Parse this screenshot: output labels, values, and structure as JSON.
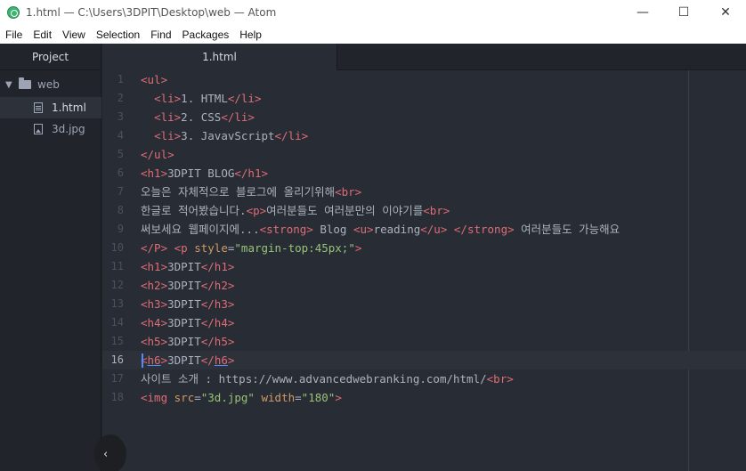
{
  "window": {
    "title": "1.html — C:\\Users\\3DPIT\\Desktop\\web — Atom",
    "minimize_glyph": "—",
    "maximize_glyph": "☐",
    "close_glyph": "✕",
    "app_icon": "atom-icon"
  },
  "menu": [
    "File",
    "Edit",
    "View",
    "Selection",
    "Find",
    "Packages",
    "Help"
  ],
  "sidebar": {
    "header": "Project",
    "tree": [
      {
        "label": "web",
        "type": "folder",
        "icon": "folder-icon",
        "expanded": true
      },
      {
        "label": "1.html",
        "type": "file",
        "icon": "file-text-icon",
        "selected": true
      },
      {
        "label": "3d.jpg",
        "type": "file",
        "icon": "file-image-icon"
      }
    ],
    "collapse_glyph": "‹"
  },
  "tabs": [
    {
      "label": "1.html",
      "active": true
    }
  ],
  "editor": {
    "cursor_line": 16,
    "lines": [
      {
        "n": "1",
        "tokens": [
          [
            "t",
            "<ul>"
          ]
        ]
      },
      {
        "n": "2",
        "tokens": [
          [
            "m",
            "  "
          ],
          [
            "t",
            "<li>"
          ],
          [
            "m",
            "1. HTML"
          ],
          [
            "t",
            "</li>"
          ]
        ]
      },
      {
        "n": "3",
        "tokens": [
          [
            "m",
            "  "
          ],
          [
            "t",
            "<li>"
          ],
          [
            "m",
            "2. CSS"
          ],
          [
            "t",
            "</li>"
          ]
        ]
      },
      {
        "n": "4",
        "tokens": [
          [
            "m",
            "  "
          ],
          [
            "t",
            "<li>"
          ],
          [
            "m",
            "3. JavavScript"
          ],
          [
            "t",
            "</li>"
          ]
        ]
      },
      {
        "n": "5",
        "tokens": [
          [
            "t",
            "</ul>"
          ]
        ]
      },
      {
        "n": "6",
        "tokens": [
          [
            "t",
            "<h1>"
          ],
          [
            "m",
            "3DPIT BLOG"
          ],
          [
            "t",
            "</h1>"
          ]
        ]
      },
      {
        "n": "7",
        "tokens": [
          [
            "m",
            "오늘은 자체적으로 블로그에 올리기위해"
          ],
          [
            "t",
            "<br>"
          ]
        ]
      },
      {
        "n": "8",
        "tokens": [
          [
            "m",
            "한글로 적어봤습니다."
          ],
          [
            "t",
            "<p>"
          ],
          [
            "m",
            "여러분들도 여러분만의 이야기를"
          ],
          [
            "t",
            "<br>"
          ]
        ]
      },
      {
        "n": "9",
        "tokens": [
          [
            "m",
            "써보세요 웹페이지에..."
          ],
          [
            "t",
            "<strong>"
          ],
          [
            "m",
            " Blog "
          ],
          [
            "t",
            "<u>"
          ],
          [
            "m",
            "reading"
          ],
          [
            "t",
            "</u>"
          ],
          [
            "m",
            " "
          ],
          [
            "t",
            "</strong>"
          ],
          [
            "m",
            " 여러분들도 가능해요"
          ]
        ]
      },
      {
        "n": "10",
        "tokens": [
          [
            "t",
            "</P>"
          ],
          [
            "m",
            " "
          ],
          [
            "t",
            "<p "
          ],
          [
            "a",
            "style"
          ],
          [
            "m",
            "="
          ],
          [
            "s",
            "\"margin-top:45px;\""
          ],
          [
            "t",
            ">"
          ]
        ]
      },
      {
        "n": "11",
        "tokens": [
          [
            "t",
            "<h1>"
          ],
          [
            "m",
            "3DPIT"
          ],
          [
            "t",
            "</h1>"
          ]
        ]
      },
      {
        "n": "12",
        "tokens": [
          [
            "t",
            "<h2>"
          ],
          [
            "m",
            "3DPIT"
          ],
          [
            "t",
            "</h2>"
          ]
        ]
      },
      {
        "n": "13",
        "tokens": [
          [
            "t",
            "<h3>"
          ],
          [
            "m",
            "3DPIT"
          ],
          [
            "t",
            "</h3>"
          ]
        ]
      },
      {
        "n": "14",
        "tokens": [
          [
            "t",
            "<h4>"
          ],
          [
            "m",
            "3DPIT"
          ],
          [
            "t",
            "</h4>"
          ]
        ]
      },
      {
        "n": "15",
        "tokens": [
          [
            "t",
            "<h5>"
          ],
          [
            "m",
            "3DPIT"
          ],
          [
            "t",
            "</h5>"
          ]
        ]
      },
      {
        "n": "16",
        "tokens": [
          [
            "t",
            "<"
          ],
          [
            "tu",
            "h6"
          ],
          [
            "t",
            ">"
          ],
          [
            "m",
            "3DPIT"
          ],
          [
            "t",
            "</"
          ],
          [
            "tu",
            "h6"
          ],
          [
            "t",
            ">"
          ]
        ]
      },
      {
        "n": "17",
        "tokens": [
          [
            "m",
            "사이트 소개 : https://www.advancedwebranking.com/html/"
          ],
          [
            "t",
            "<br>"
          ]
        ]
      },
      {
        "n": "18",
        "tokens": [
          [
            "t",
            "<img "
          ],
          [
            "a",
            "src"
          ],
          [
            "m",
            "="
          ],
          [
            "s",
            "\"3d.jpg\""
          ],
          [
            "m",
            " "
          ],
          [
            "a",
            "width"
          ],
          [
            "m",
            "="
          ],
          [
            "s",
            "\"180\""
          ],
          [
            "t",
            ">"
          ]
        ]
      }
    ]
  },
  "colors": {
    "tag": "#e06c75",
    "attribute": "#d19a66",
    "string": "#98c379",
    "text": "#abb2bf",
    "editor_bg": "#282c34",
    "panel_bg": "#21252b",
    "cursor": "#528bff"
  }
}
